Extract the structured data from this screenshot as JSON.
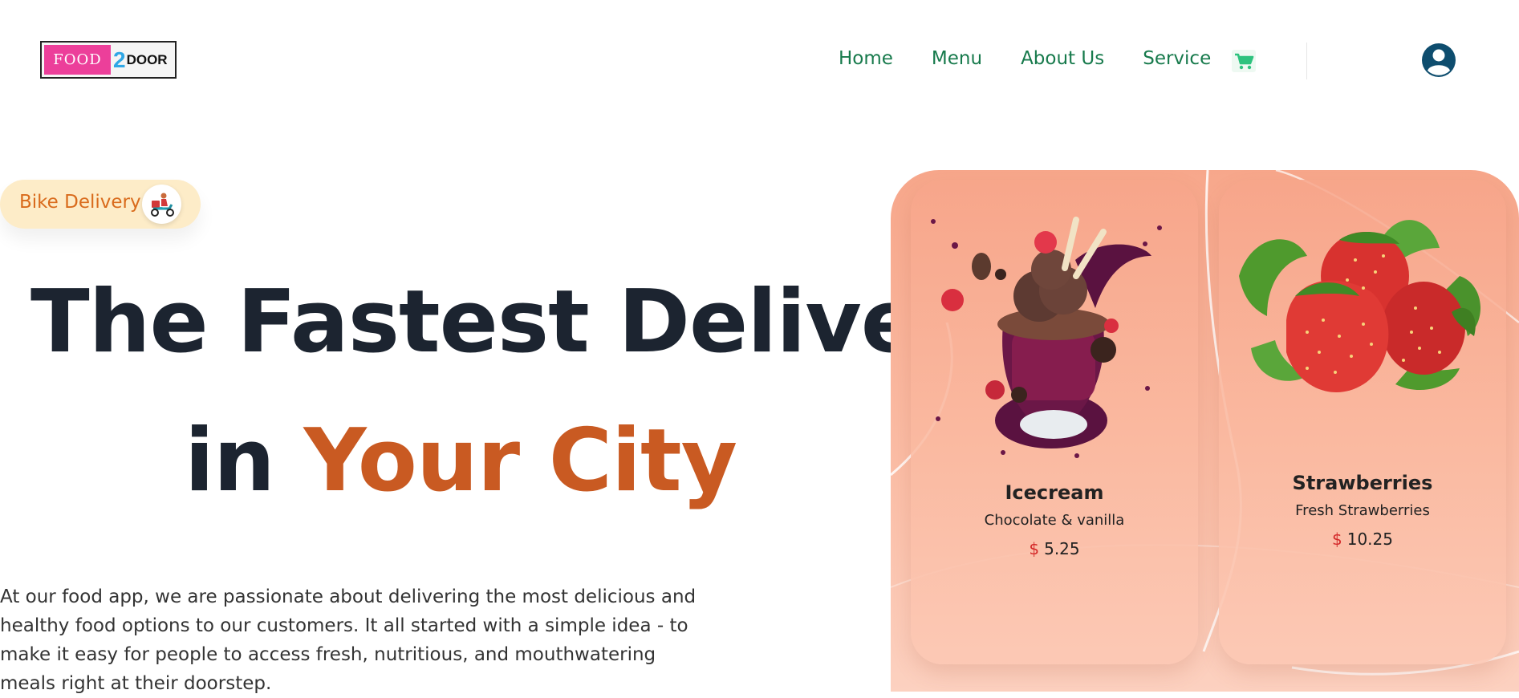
{
  "header": {
    "logo": {
      "part1": "FOOD",
      "part2": "2",
      "part3": "DOOR"
    },
    "nav": [
      "Home",
      "Menu",
      "About Us",
      "Service"
    ],
    "icons": {
      "cart": "cart-icon",
      "user": "user-avatar-icon"
    }
  },
  "hero": {
    "badge": {
      "label": "Bike Delivery",
      "icon": "scooter-delivery-icon"
    },
    "title_line1": "The Fastest Delivery",
    "title_line2_prefix": "in",
    "title_line2_accent": "Your City",
    "description": "At our food app, we are passionate about delivering the most delicious and healthy food options to our customers. It all started with a simple idea - to make it easy for people to access fresh, nutritious, and mouthwatering meals right at their doorstep."
  },
  "products": [
    {
      "name": "Icecream",
      "description": "Chocolate & vanilla",
      "currency": "$",
      "price": "5.25"
    },
    {
      "name": "Strawberries",
      "description": "Fresh Strawberries",
      "currency": "$",
      "price": "10.25"
    }
  ],
  "colors": {
    "nav": "#177a4c",
    "accent": "#c95a22",
    "heading": "#1c2430",
    "badge_bg": "#fdecc8",
    "panel": "#f7a78b",
    "price_currency": "#d42a2a"
  }
}
